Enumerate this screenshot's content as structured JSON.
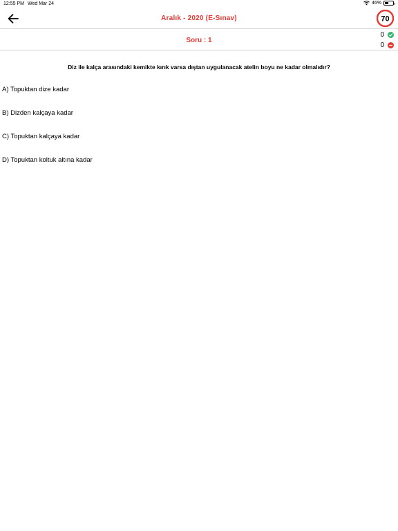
{
  "status_bar": {
    "time": "12:55 PM",
    "date": "Wed Mar 24",
    "battery": "46%",
    "battery_level": 0.46
  },
  "header": {
    "title": "Aralık - 2020  (E-Sınav)",
    "speed_badge": "70",
    "accent_color": "#e53935"
  },
  "subheader": {
    "question_number": "Soru : 1",
    "correct_count": "0",
    "wrong_count": "0"
  },
  "question": {
    "text": "Diz ile kalça arasındaki kemikte kırık varsa dıştan uygulanacak atelin boyu ne kadar olmalıdır?",
    "options": [
      {
        "label": "A) Topuktan dize kadar"
      },
      {
        "label": "B) Dizden kalçaya kadar"
      },
      {
        "label": "C) Topuktan kalçaya kadar"
      },
      {
        "label": "D) Topuktan koltuk altına kadar"
      }
    ]
  }
}
